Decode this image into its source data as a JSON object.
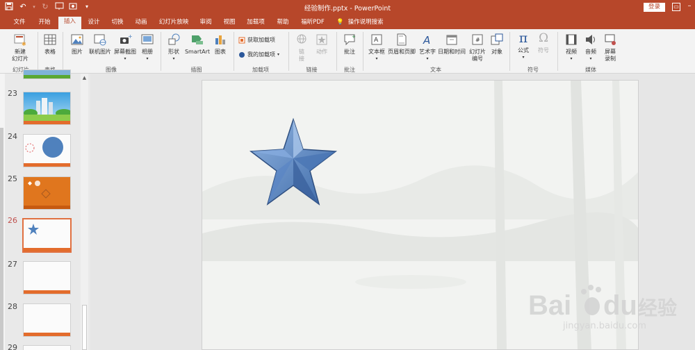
{
  "titlebar": {
    "document_title": "经验制作.pptx  -  PowerPoint",
    "login_label": "登录"
  },
  "tabs": [
    {
      "label": "文件"
    },
    {
      "label": "开始"
    },
    {
      "label": "插入",
      "active": true
    },
    {
      "label": "设计"
    },
    {
      "label": "切换"
    },
    {
      "label": "动画"
    },
    {
      "label": "幻灯片放映"
    },
    {
      "label": "审阅"
    },
    {
      "label": "视图"
    },
    {
      "label": "加载项"
    },
    {
      "label": "帮助"
    },
    {
      "label": "福昕PDF"
    }
  ],
  "tell_me": "操作说明搜索",
  "ribbon": {
    "new_slide": "新建\n幻灯片",
    "table": "表格",
    "picture": "图片",
    "online_picture": "联机图片",
    "screenshot": "屏幕截图",
    "album": "相册",
    "shapes": "形状",
    "smartart": "SmartArt",
    "chart": "图表",
    "get_addins": "获取加载项",
    "my_addins": "我的加载项",
    "link": "链\n接",
    "action": "动作",
    "comment": "批注",
    "textbox": "文本框",
    "header_footer": "页眉和页脚",
    "wordart": "艺术字",
    "datetime": "日期和时间",
    "slide_number": "幻灯片\n编号",
    "object": "对象",
    "equation": "公式",
    "symbol": "符号",
    "video": "视频",
    "audio": "音频",
    "screen_recording": "屏幕\n录制"
  },
  "groups": {
    "slides": "幻灯片",
    "tables": "表格",
    "images": "图像",
    "illustrations": "插图",
    "addins": "加载项",
    "links": "链接",
    "comments": "批注",
    "text": "文本",
    "symbols": "符号",
    "media": "媒体"
  },
  "slides_panel": {
    "slides": [
      {
        "number": "23"
      },
      {
        "number": "24"
      },
      {
        "number": "25"
      },
      {
        "number": "26",
        "active": true
      },
      {
        "number": "27"
      },
      {
        "number": "28"
      },
      {
        "number": "29"
      }
    ]
  },
  "watermark": {
    "url": "jingyan.baidu.com"
  },
  "colors": {
    "accent": "#b7472a",
    "star_fill": "#4f81bd",
    "slide_footer": "#e36c2c"
  }
}
